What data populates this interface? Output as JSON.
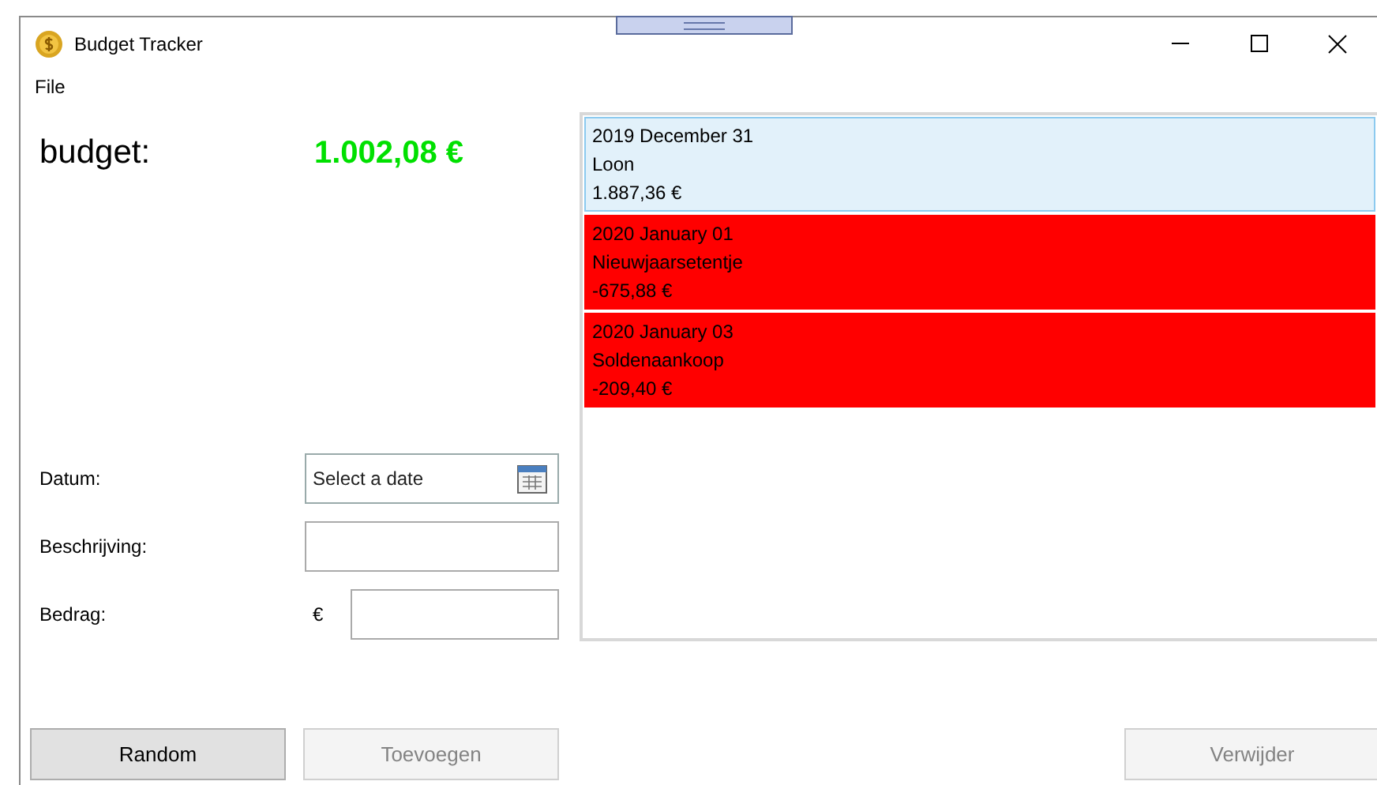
{
  "window": {
    "title": "Budget Tracker"
  },
  "menu": [
    "File"
  ],
  "budget": {
    "label": "budget:",
    "value": "1.002,08 €"
  },
  "form": {
    "date": {
      "label": "Datum:",
      "placeholder": "Select a date"
    },
    "description": {
      "label": "Beschrijving:"
    },
    "amount": {
      "label": "Bedrag:",
      "currency": "€"
    }
  },
  "transactions": [
    {
      "date": "2019 December 31",
      "description": "Loon",
      "amount": "1.887,36 €",
      "kind": "income",
      "selected": true
    },
    {
      "date": "2020 January 01",
      "description": "Nieuwjaarsetentje",
      "amount": "-675,88 €",
      "kind": "expense",
      "selected": false
    },
    {
      "date": "2020 January 03",
      "description": "Soldenaankoop",
      "amount": "-209,40 €",
      "kind": "expense",
      "selected": false
    }
  ],
  "buttons": [
    {
      "label": "Random",
      "disabled": false
    },
    {
      "label": "Toevoegen",
      "disabled": true
    },
    {
      "label": "Verwijder",
      "disabled": true
    }
  ]
}
